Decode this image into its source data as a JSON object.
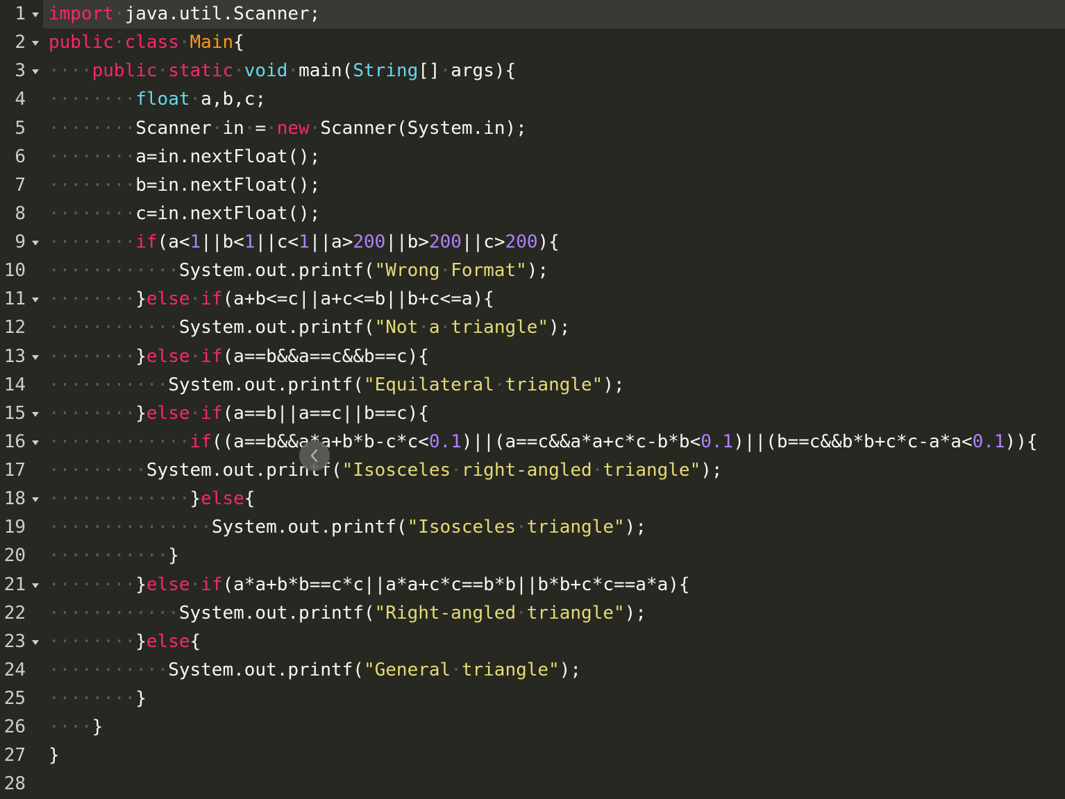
{
  "theme": {
    "background": "#272822",
    "active_line": "#3a3a34",
    "gutter_text": "#cfcfc6",
    "text": "#f8f8f2",
    "keyword": "#f92672",
    "type": "#66d9ef",
    "class_name": "#fd971f",
    "number": "#ae81ff",
    "string": "#e6db74",
    "invisible": "#5c5c55",
    "overlay": "#5e5e5a",
    "overlay_icon": "#d8d8d4"
  },
  "overlay_button": {
    "icon": "chevron-left-icon"
  },
  "editor": {
    "active_line": 1,
    "lines": [
      {
        "line_no": "1",
        "fold": true,
        "tokens": [
          {
            "kw": "import"
          },
          {
            "ws": "·"
          },
          {
            "txt": "java.util.Scanner;"
          }
        ]
      },
      {
        "line_no": "2",
        "fold": true,
        "tokens": [
          {
            "kw": "public"
          },
          {
            "ws": "·"
          },
          {
            "kw": "class"
          },
          {
            "ws": "·"
          },
          {
            "cls": "Main"
          },
          {
            "txt": "{"
          }
        ]
      },
      {
        "line_no": "3",
        "fold": true,
        "tokens": [
          {
            "ws": "····"
          },
          {
            "kw": "public"
          },
          {
            "ws": "·"
          },
          {
            "kw": "static"
          },
          {
            "ws": "·"
          },
          {
            "type": "void"
          },
          {
            "ws": "·"
          },
          {
            "txt": "main("
          },
          {
            "type": "String"
          },
          {
            "txt": "[]"
          },
          {
            "ws": "·"
          },
          {
            "txt": "args){"
          }
        ]
      },
      {
        "line_no": "4",
        "fold": false,
        "tokens": [
          {
            "ws": "········"
          },
          {
            "type": "float"
          },
          {
            "ws": "·"
          },
          {
            "txt": "a,b,c;"
          }
        ]
      },
      {
        "line_no": "5",
        "fold": false,
        "tokens": [
          {
            "ws": "········"
          },
          {
            "txt": "Scanner"
          },
          {
            "ws": "·"
          },
          {
            "txt": "in"
          },
          {
            "ws": "·"
          },
          {
            "txt": "="
          },
          {
            "ws": "·"
          },
          {
            "kw": "new"
          },
          {
            "ws": "·"
          },
          {
            "txt": "Scanner(System.in);"
          }
        ]
      },
      {
        "line_no": "6",
        "fold": false,
        "tokens": [
          {
            "ws": "········"
          },
          {
            "txt": "a=in.nextFloat();"
          }
        ]
      },
      {
        "line_no": "7",
        "fold": false,
        "tokens": [
          {
            "ws": "········"
          },
          {
            "txt": "b=in.nextFloat();"
          }
        ]
      },
      {
        "line_no": "8",
        "fold": false,
        "tokens": [
          {
            "ws": "········"
          },
          {
            "txt": "c=in.nextFloat();"
          }
        ]
      },
      {
        "line_no": "9",
        "fold": true,
        "tokens": [
          {
            "ws": "········"
          },
          {
            "kw": "if"
          },
          {
            "txt": "(a<"
          },
          {
            "num": "1"
          },
          {
            "txt": "||b<"
          },
          {
            "num": "1"
          },
          {
            "txt": "||c<"
          },
          {
            "num": "1"
          },
          {
            "txt": "||a>"
          },
          {
            "num": "200"
          },
          {
            "txt": "||b>"
          },
          {
            "num": "200"
          },
          {
            "txt": "||c>"
          },
          {
            "num": "200"
          },
          {
            "txt": "){"
          }
        ]
      },
      {
        "line_no": "10",
        "fold": false,
        "tokens": [
          {
            "ws": "············"
          },
          {
            "txt": "System.out.printf("
          },
          {
            "str": "\"Wrong"
          },
          {
            "ws": "·"
          },
          {
            "str": "Format\""
          },
          {
            "txt": ");"
          }
        ]
      },
      {
        "line_no": "11",
        "fold": true,
        "tokens": [
          {
            "ws": "········"
          },
          {
            "txt": "}"
          },
          {
            "kw": "else"
          },
          {
            "ws": "·"
          },
          {
            "kw": "if"
          },
          {
            "txt": "(a+b<=c||a+c<=b||b+c<=a){"
          }
        ]
      },
      {
        "line_no": "12",
        "fold": false,
        "tokens": [
          {
            "ws": "············"
          },
          {
            "txt": "System.out.printf("
          },
          {
            "str": "\"Not"
          },
          {
            "ws": "·"
          },
          {
            "str": "a"
          },
          {
            "ws": "·"
          },
          {
            "str": "triangle\""
          },
          {
            "txt": ");"
          }
        ]
      },
      {
        "line_no": "13",
        "fold": true,
        "tokens": [
          {
            "ws": "········"
          },
          {
            "txt": "}"
          },
          {
            "kw": "else"
          },
          {
            "ws": "·"
          },
          {
            "kw": "if"
          },
          {
            "txt": "(a==b&&a==c&&b==c){"
          }
        ]
      },
      {
        "line_no": "14",
        "fold": false,
        "tokens": [
          {
            "ws": "···········"
          },
          {
            "txt": "System.out.printf("
          },
          {
            "str": "\"Equilateral"
          },
          {
            "ws": "·"
          },
          {
            "str": "triangle\""
          },
          {
            "txt": ");"
          }
        ]
      },
      {
        "line_no": "15",
        "fold": true,
        "tokens": [
          {
            "ws": "········"
          },
          {
            "txt": "}"
          },
          {
            "kw": "else"
          },
          {
            "ws": "·"
          },
          {
            "kw": "if"
          },
          {
            "txt": "(a==b||a==c||b==c){"
          }
        ]
      },
      {
        "line_no": "16",
        "fold": true,
        "tokens": [
          {
            "ws": "·············"
          },
          {
            "kw": "if"
          },
          {
            "txt": "((a==b&&a*a+b*b-c*c<"
          },
          {
            "num": "0.1"
          },
          {
            "txt": ")||(a==c&&a*a+c*c-b*b<"
          },
          {
            "num": "0.1"
          },
          {
            "txt": ")||(b==c&&b*b+c*c-a*a<"
          },
          {
            "num": "0.1"
          },
          {
            "txt": ")){"
          }
        ]
      },
      {
        "line_no": "17",
        "fold": false,
        "tokens": [
          {
            "ws": "·········"
          },
          {
            "txt": "System.out.printf("
          },
          {
            "str": "\"Isosceles"
          },
          {
            "ws": "·"
          },
          {
            "str": "right-angled"
          },
          {
            "ws": "·"
          },
          {
            "str": "triangle\""
          },
          {
            "txt": ");"
          }
        ]
      },
      {
        "line_no": "18",
        "fold": true,
        "tokens": [
          {
            "ws": "·············"
          },
          {
            "txt": "}"
          },
          {
            "kw": "else"
          },
          {
            "txt": "{"
          }
        ]
      },
      {
        "line_no": "19",
        "fold": false,
        "tokens": [
          {
            "ws": "···············"
          },
          {
            "txt": "System.out.printf("
          },
          {
            "str": "\"Isosceles"
          },
          {
            "ws": "·"
          },
          {
            "str": "triangle\""
          },
          {
            "txt": ");"
          }
        ]
      },
      {
        "line_no": "20",
        "fold": false,
        "tokens": [
          {
            "ws": "···········"
          },
          {
            "txt": "}"
          }
        ]
      },
      {
        "line_no": "21",
        "fold": true,
        "tokens": [
          {
            "ws": "········"
          },
          {
            "txt": "}"
          },
          {
            "kw": "else"
          },
          {
            "ws": "·"
          },
          {
            "kw": "if"
          },
          {
            "txt": "(a*a+b*b==c*c||a*a+c*c==b*b||b*b+c*c==a*a){"
          }
        ]
      },
      {
        "line_no": "22",
        "fold": false,
        "tokens": [
          {
            "ws": "············"
          },
          {
            "txt": "System.out.printf("
          },
          {
            "str": "\"Right-angled"
          },
          {
            "ws": "·"
          },
          {
            "str": "triangle\""
          },
          {
            "txt": ");"
          }
        ]
      },
      {
        "line_no": "23",
        "fold": true,
        "tokens": [
          {
            "ws": "········"
          },
          {
            "txt": "}"
          },
          {
            "kw": "else"
          },
          {
            "txt": "{"
          }
        ]
      },
      {
        "line_no": "24",
        "fold": false,
        "tokens": [
          {
            "ws": "···········"
          },
          {
            "txt": "System.out.printf("
          },
          {
            "str": "\"General"
          },
          {
            "ws": "·"
          },
          {
            "str": "triangle\""
          },
          {
            "txt": ");"
          }
        ]
      },
      {
        "line_no": "25",
        "fold": false,
        "tokens": [
          {
            "ws": "········"
          },
          {
            "txt": "}"
          }
        ]
      },
      {
        "line_no": "26",
        "fold": false,
        "tokens": [
          {
            "ws": "····"
          },
          {
            "txt": "}"
          }
        ]
      },
      {
        "line_no": "27",
        "fold": false,
        "tokens": [
          {
            "txt": "}"
          }
        ]
      },
      {
        "line_no": "28",
        "fold": false,
        "tokens": []
      }
    ]
  }
}
